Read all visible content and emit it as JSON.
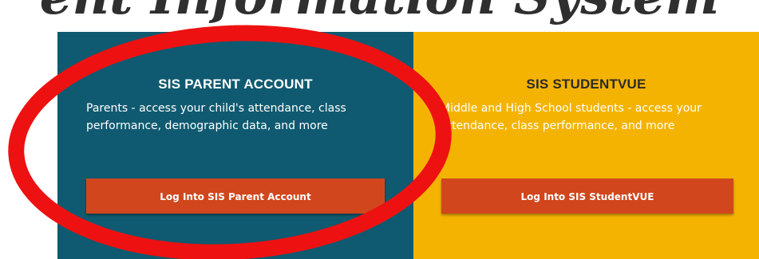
{
  "page": {
    "heading": "ent Information System"
  },
  "parent_card": {
    "title": "SIS PARENT ACCOUNT",
    "description": "Parents - access your child's attendance, class performance, demographic data, and more",
    "button_label": "Log Into SIS Parent Account",
    "background_color": "#0f5a70",
    "button_color": "#d1461c"
  },
  "student_card": {
    "title": "SIS STUDENTVUE",
    "description": "Middle and High School students - access your attendance, class performance, and more",
    "button_label": "Log Into SIS StudentVUE",
    "background_color": "#f5b301",
    "button_color": "#d1461c"
  },
  "annotation": {
    "shape": "ellipse",
    "color": "#ee1111"
  }
}
